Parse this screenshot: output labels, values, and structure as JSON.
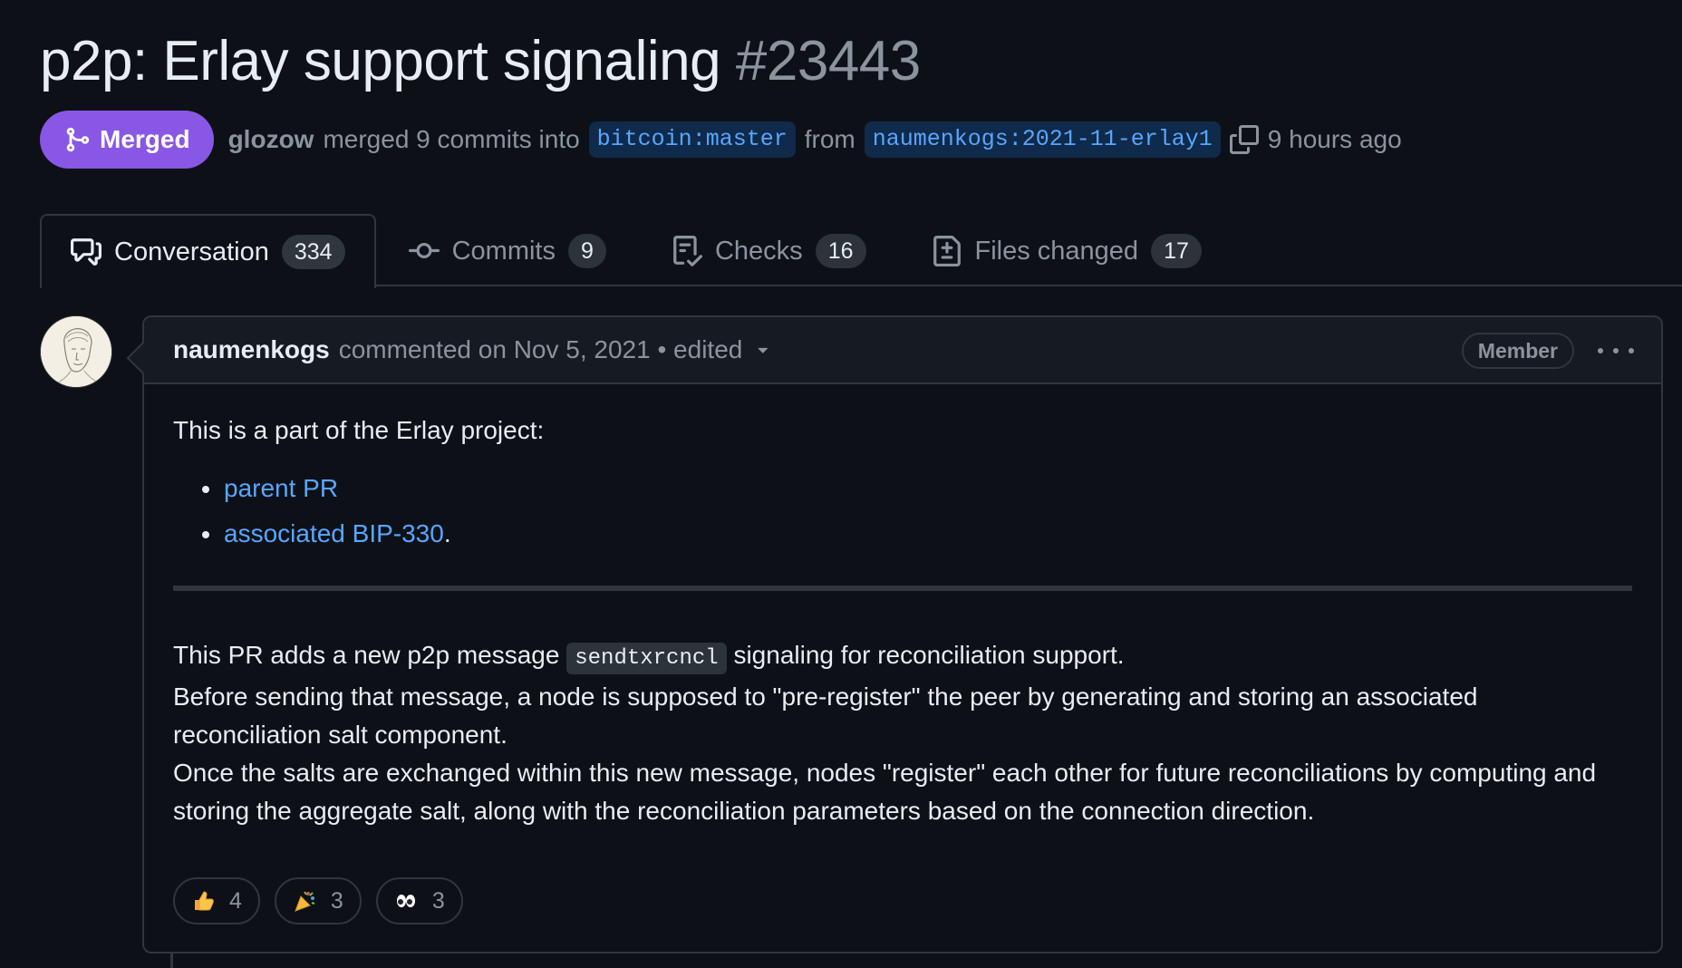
{
  "pr": {
    "title": "p2p: Erlay support signaling",
    "number": "#23443",
    "state_label": "Merged",
    "merged_by": "glozow",
    "merged_text": "merged 9 commits into",
    "base_branch": "bitcoin:master",
    "from_text": "from",
    "head_branch": "naumenkogs:2021-11-erlay1",
    "time_ago": "9 hours ago"
  },
  "tabs": [
    {
      "label": "Conversation",
      "count": "334",
      "icon": "comment-discussion-icon"
    },
    {
      "label": "Commits",
      "count": "9",
      "icon": "git-commit-icon"
    },
    {
      "label": "Checks",
      "count": "16",
      "icon": "checklist-icon"
    },
    {
      "label": "Files changed",
      "count": "17",
      "icon": "file-diff-icon"
    }
  ],
  "comment": {
    "author": "naumenkogs",
    "meta": "commented on Nov 5, 2021 • edited",
    "role": "Member",
    "intro": "This is a part of the Erlay project:",
    "links": [
      {
        "text": "parent PR",
        "suffix": ""
      },
      {
        "text": "associated BIP-330",
        "suffix": "."
      }
    ],
    "para1_before": "This PR adds a new p2p message",
    "para1_code": "sendtxrcncl",
    "para1_after": "signaling for reconciliation support.",
    "para2": "Before sending that message, a node is supposed to \"pre-register\" the peer by generating and storing an associated reconciliation salt component.",
    "para3": "Once the salts are exchanged within this new message, nodes \"register\" each other for future reconciliations by computing and storing the aggregate salt, along with the reconciliation parameters based on the connection direction.",
    "reactions": [
      {
        "emoji": "thumbs-up",
        "count": "4"
      },
      {
        "emoji": "party-popper",
        "count": "3"
      },
      {
        "emoji": "eyes",
        "count": "3"
      }
    ]
  },
  "colors": {
    "background": "#0d1117",
    "merged": "#8957e5",
    "link": "#58a6ff",
    "border": "#30363d",
    "muted": "#8b949e"
  }
}
